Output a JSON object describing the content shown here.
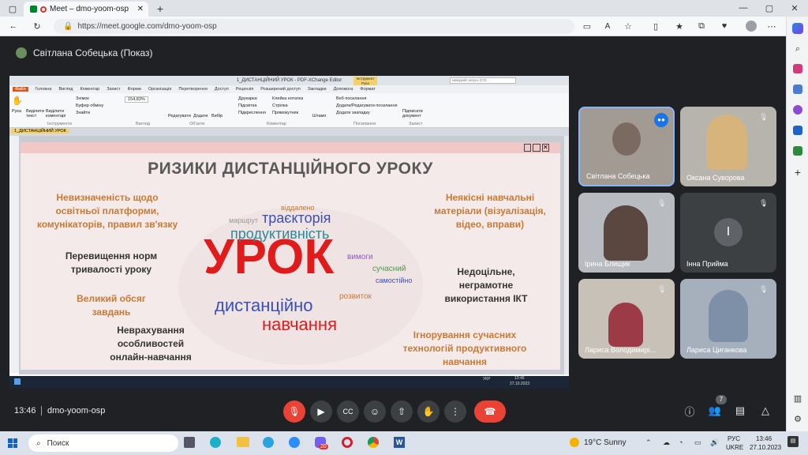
{
  "browser": {
    "tab_title": "Meet – dmo-yoom-osp",
    "url": "https://meet.google.com/dmo-yoom-osp"
  },
  "meet": {
    "presenter_label": "Світлана Собецька (Показ)",
    "time": "13:46",
    "meeting_code": "dmo-yoom-osp",
    "people_count": "7"
  },
  "pdf": {
    "window_title": "1_ДИСТАНЦІЙНИЙ УРОК - PDF-XChange Editor",
    "menu": [
      "Файл",
      "Головна",
      "Вигляд",
      "Коментар",
      "Захист",
      "Форми",
      "Організація",
      "Перетворення",
      "Доступ",
      "Рецензія",
      "Розширений доступ",
      "Закладки",
      "Допомога",
      "Формат"
    ],
    "search_placeholder": "Швидкий запуск (Ctrl...",
    "doc_tab": "1_ДИСТАНЦІЙНИЙ УРОК",
    "zoom": "154,83%",
    "ribbon": [
      "Рука",
      "Виділити текст",
      "Виділити коментарі",
      "Знімок",
      "Буфер обміну",
      "Знайти",
      "Редагувати",
      "Додати",
      "Вибір",
      "Друкарка",
      "Підсвітка",
      "Підкреслення",
      "Клейка нотатка",
      "Стрілка",
      "Прямокутник",
      "Штамп",
      "Веб посилання",
      "Додати/Редагувати посилання",
      "Додати закладку",
      "Підписати документ"
    ],
    "groups": [
      "Інструменти",
      "Вигляд",
      "Об'єкти",
      "Коментар",
      "Посилання",
      "Захист"
    ],
    "tool_label": "Інструмент Рука"
  },
  "slide": {
    "title": "РИЗИКИ ДИСТАНЦІЙНОГО УРОКУ",
    "left_items": [
      "Невизначеність щодо освітньої платформи, комунікаторів, правил зв'язку",
      "Перевищення норм тривалості уроку",
      "Великий обсяг завдань",
      "Неврахування особливостей онлайн-навчання"
    ],
    "right_items": [
      "Неякісні навчальні матеріали (візуалізація, відео, вправи)",
      "Недоцільне, неграмотне використання ІКТ",
      "Ігнорування сучасних технологій продуктивного навчання"
    ],
    "cloud_words": {
      "big": "УРОК",
      "w1": "траєкторія",
      "w2": "продуктивність",
      "w3": "дистанційно",
      "w4": "навчання",
      "w5": "віддалено",
      "w6": "вимоги",
      "w7": "сучасний",
      "w8": "розвиток",
      "w9": "маршрут",
      "w10": "самостійно"
    },
    "clock": "13:46",
    "date": "27.10.2023",
    "lang": "УКР"
  },
  "participants": [
    {
      "name": "Світлана Собецька"
    },
    {
      "name": "Оксана Суворова"
    },
    {
      "name": "Ірина Блищик"
    },
    {
      "name": "Інна Прийма",
      "initial": "І"
    },
    {
      "name": "Лариса Володимирі..."
    },
    {
      "name": "Лариса Циганкова"
    }
  ],
  "taskbar": {
    "search": "Поиск",
    "weather": "19°C  Sunny",
    "lang1": "РУС",
    "lang2": "UKRE",
    "time": "13:46",
    "date": "27.10.2023",
    "viber_badge": "20"
  },
  "colors": {
    "accent": "#1a73e8",
    "end_call": "#ea4335",
    "mic_off": "#ea4335",
    "slide_red": "#e01b1b",
    "slide_blue": "#3b4fb8",
    "slide_teal": "#2a8a9a"
  }
}
